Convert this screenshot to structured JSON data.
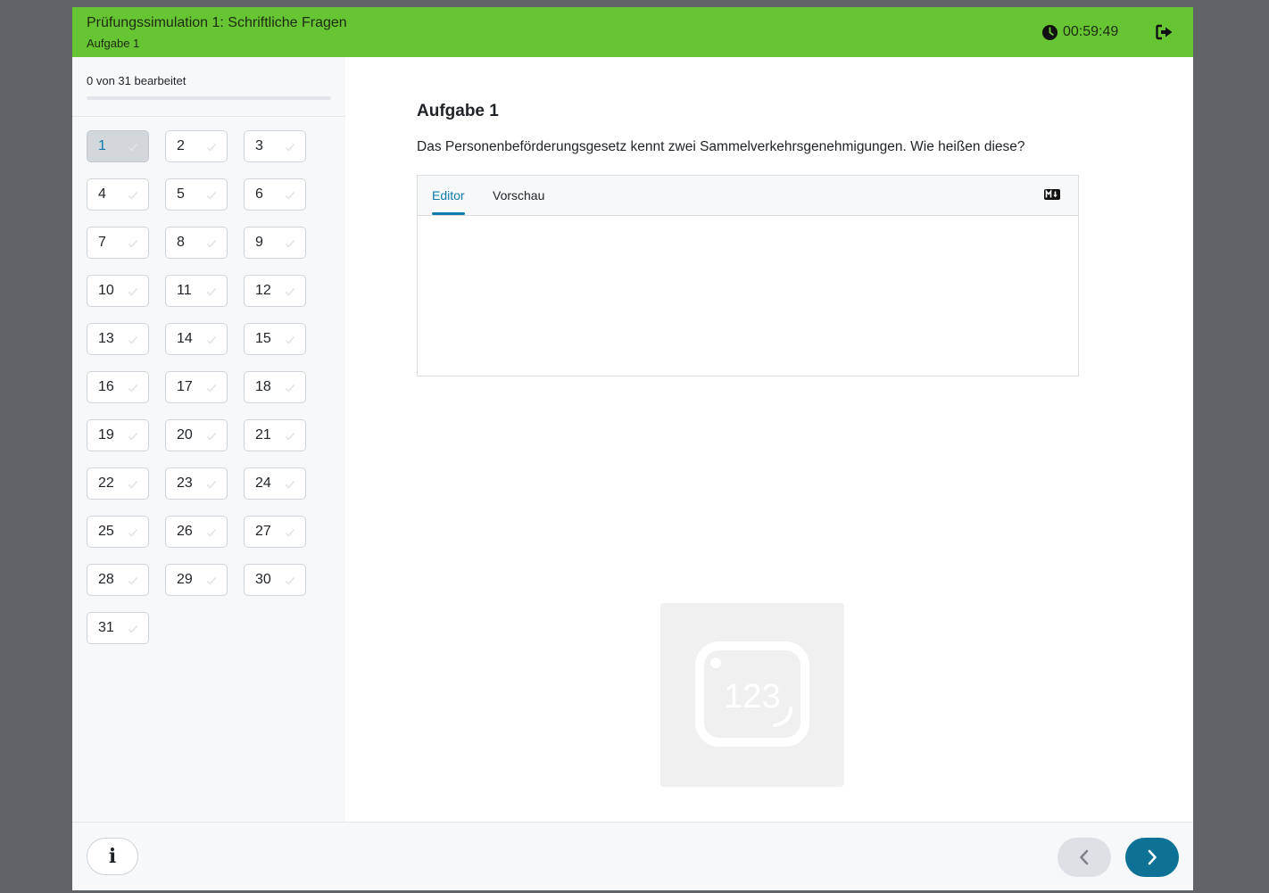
{
  "header": {
    "title": "Prüfungssimulation 1: Schriftliche Fragen",
    "subtitle": "Aufgabe 1",
    "timer": "00:59:49",
    "timer_icon": "clock-icon",
    "exit_icon": "sign-out-icon",
    "color": "#67c534"
  },
  "sidebar": {
    "progress_text": "0 von 31 bearbeitet",
    "progress_fraction": 0,
    "active_task": 1,
    "tasks": [
      "1",
      "2",
      "3",
      "4",
      "5",
      "6",
      "7",
      "8",
      "9",
      "10",
      "11",
      "12",
      "13",
      "14",
      "15",
      "16",
      "17",
      "18",
      "19",
      "20",
      "21",
      "22",
      "23",
      "24",
      "25",
      "26",
      "27",
      "28",
      "29",
      "30",
      "31"
    ]
  },
  "main": {
    "task_title": "Aufgabe 1",
    "question": "Das Personenbeförderungsgesetz kennt zwei Sammelverkehrsgenehmigungen. Wie heißen diese?",
    "editor": {
      "tabs": [
        "Editor",
        "Vorschau"
      ],
      "active_tab": "Editor",
      "markdown_icon": "markdown-icon",
      "value": ""
    },
    "placeholder_image_text": "123"
  },
  "footer": {
    "info_label": "i",
    "prev_icon": "chevron-left-icon",
    "next_icon": "chevron-right-icon"
  },
  "colors": {
    "accent": "#0f7bab",
    "next_button": "#0e7296",
    "header_green": "#67c534"
  }
}
